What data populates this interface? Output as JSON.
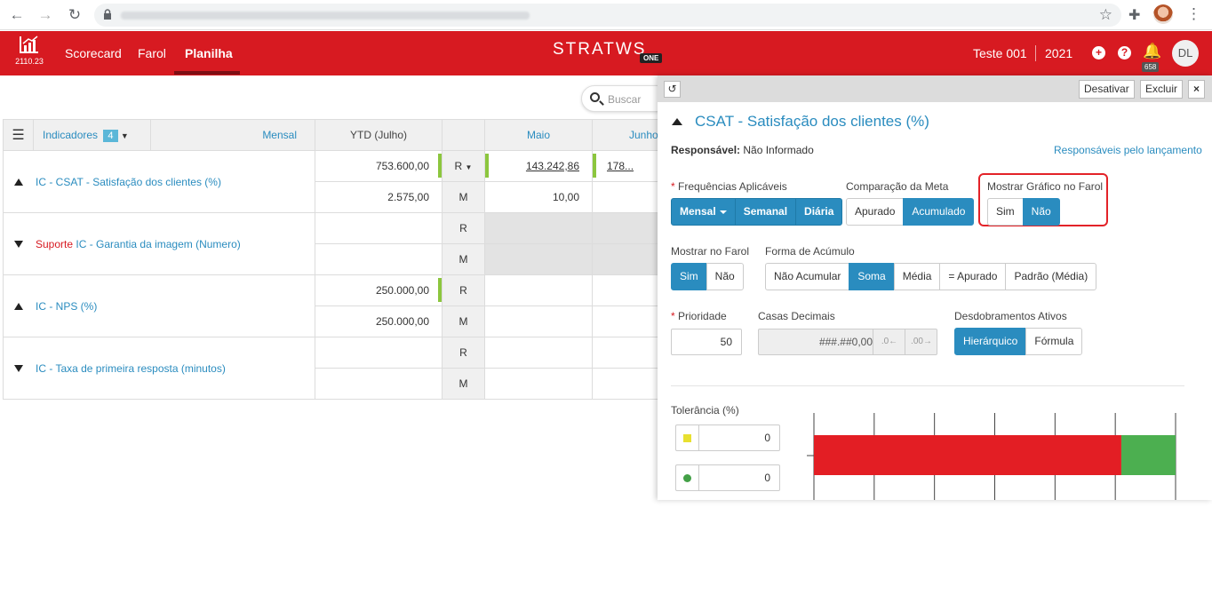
{
  "browser": {
    "back_icon": "arrow-left-icon",
    "forward_icon": "arrow-right-icon",
    "reload_icon": "reload-icon"
  },
  "app": {
    "version": "2110.23",
    "nav": [
      "Scorecard",
      "Farol",
      "Planilha"
    ],
    "brand": "STRATWS",
    "brand_badge": "ONE",
    "company": "Teste 001",
    "year": "2021",
    "notif_count": "658",
    "avatar": "DL",
    "accent_color": "#d71a21"
  },
  "search": {
    "placeholder": "Buscar"
  },
  "grid": {
    "indicators_label": "Indicadores",
    "indicators_count": "4",
    "period_label": "Mensal",
    "ytd_label": "YTD (Julho)",
    "months": [
      "Maio",
      "Junho"
    ],
    "rows": [
      {
        "expanded": true,
        "prefix": "",
        "name": "IC - CSAT - Satisfação dos clientes (%)",
        "r": {
          "ytd": "753.600,00",
          "label": "R",
          "maio": "143.242,86",
          "junho": "178..."
        },
        "m": {
          "ytd": "2.575,00",
          "label": "M",
          "maio": "10,00",
          "junho": ""
        }
      },
      {
        "expanded": false,
        "prefix": "Suporte",
        "name": "IC - Garantia da imagem (Numero)",
        "r": {
          "ytd": "",
          "label": "R",
          "maio": "",
          "junho": ""
        },
        "m": {
          "ytd": "",
          "label": "M",
          "maio": "",
          "junho": ""
        }
      },
      {
        "expanded": true,
        "prefix": "",
        "name": "IC - NPS (%)",
        "r": {
          "ytd": "250.000,00",
          "label": "R",
          "maio": "",
          "junho": ""
        },
        "m": {
          "ytd": "250.000,00",
          "label": "M",
          "maio": "",
          "junho": ""
        }
      },
      {
        "expanded": false,
        "prefix": "",
        "name": "IC - Taxa de primeira resposta (minutos)",
        "r": {
          "ytd": "",
          "label": "R",
          "maio": "",
          "junho": ""
        },
        "m": {
          "ytd": "",
          "label": "M",
          "maio": "",
          "junho": ""
        }
      }
    ]
  },
  "panel": {
    "deactivate": "Desativar",
    "delete": "Excluir",
    "close": "×",
    "title": "CSAT - Satisfação dos clientes (%)",
    "resp_label": "Responsável:",
    "resp_value": "Não Informado",
    "resp_link": "Responsáveis pelo lançamento",
    "freq_label": "Frequências Aplicáveis",
    "freq_options": [
      "Mensal",
      "Semanal",
      "Diária"
    ],
    "meta_label": "Comparação da Meta",
    "meta_options": [
      "Apurado",
      "Acumulado"
    ],
    "meta_selected": "Acumulado",
    "grafico_label": "Mostrar Gráfico no Farol",
    "grafico_options": [
      "Sim",
      "Não"
    ],
    "grafico_selected": "Não",
    "farol_label": "Mostrar no Farol",
    "farol_options": [
      "Sim",
      "Não"
    ],
    "farol_selected": "Sim",
    "acumulo_label": "Forma de Acúmulo",
    "acumulo_options": [
      "Não Acumular",
      "Soma",
      "Média",
      "= Apurado",
      "Padrão (Média)"
    ],
    "acumulo_selected": "Soma",
    "prioridade_label": "Prioridade",
    "prioridade_value": "50",
    "casas_label": "Casas Decimais",
    "casas_value": "###.##0,00",
    "desdob_label": "Desdobramentos Ativos",
    "desdob_options": [
      "Hierárquico",
      "Fórmula"
    ],
    "desdob_selected": "Hierárquico",
    "tol_label": "Tolerância (%)",
    "tol_yellow": "0",
    "tol_green": "0",
    "tol_yellow_color": "#e8e030",
    "tol_green_color": "#43a047"
  },
  "chart_data": {
    "type": "bar",
    "orientation": "horizontal",
    "series": [
      {
        "color": "#e31e24",
        "value": 0.85
      },
      {
        "color": "#4caf50",
        "value": 0.15
      }
    ],
    "grid": true
  }
}
